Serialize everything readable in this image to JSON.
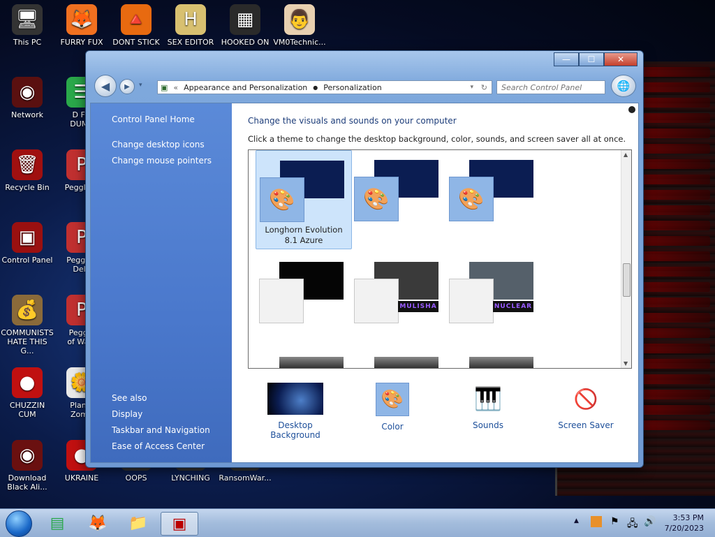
{
  "desktop": {
    "icons": [
      {
        "label": "This PC",
        "glyph": "🖥"
      },
      {
        "label": "FURRY FUX",
        "glyph": "🦊"
      },
      {
        "label": "DONT STICK",
        "glyph": "🔺"
      },
      {
        "label": "SEX EDITOR",
        "glyph": "H"
      },
      {
        "label": "HOOKED ON",
        "glyph": "▦"
      },
      {
        "label": "VM0Technic...",
        "glyph": "👨"
      },
      {
        "label": "Network",
        "glyph": "◉"
      },
      {
        "label": "D FO\nDUMB",
        "glyph": "☰"
      },
      {
        "label": "Recycle Bin",
        "glyph": "🗑"
      },
      {
        "label": "Peggle D",
        "glyph": "P"
      },
      {
        "label": "Control Panel",
        "glyph": "▣"
      },
      {
        "label": "Peggle I\nDelu",
        "glyph": "P"
      },
      {
        "label": "COMMUNISTS\nHATE THIS G...",
        "glyph": "💰"
      },
      {
        "label": "Peggle\nof Warc",
        "glyph": "P"
      },
      {
        "label": "CHUZZIN\nCUM",
        "glyph": "●"
      },
      {
        "label": "Plants\nZomb",
        "glyph": "🌼"
      },
      {
        "label": "Download\nBlack Ali...",
        "glyph": "◉"
      },
      {
        "label": "UKRAINE",
        "glyph": "●"
      },
      {
        "label": "OOPS",
        "glyph": ""
      },
      {
        "label": "LYNCHING",
        "glyph": ""
      },
      {
        "label": "RansomWar...",
        "glyph": ""
      }
    ]
  },
  "window": {
    "caption": {
      "minimize": "—",
      "maximize": "☐",
      "close": "✕"
    },
    "breadcrumb": {
      "prefix": "«",
      "items": [
        "Appearance and Personalization",
        "Personalization"
      ]
    },
    "search_placeholder": "Search Control Panel",
    "sidebar": {
      "home": "Control Panel Home",
      "links": [
        "Change desktop icons",
        "Change mouse pointers"
      ],
      "see_also_heading": "See also",
      "see_also": [
        "Display",
        "Taskbar and Navigation",
        "Ease of Access Center"
      ]
    },
    "main": {
      "title": "Change the visuals and sounds on your computer",
      "subtitle": "Click a theme to change the desktop background, color, sounds, and screen saver all at once.",
      "themes": [
        {
          "name": "Longhorn Evolution\n8.1 Azure",
          "selected": true,
          "bg": "#0b1d52",
          "badge": ""
        },
        {
          "name": "",
          "selected": false,
          "bg": "#0b1d52",
          "badge": ""
        },
        {
          "name": "",
          "selected": false,
          "bg": "#0b1d52",
          "badge": ""
        },
        {
          "name": "",
          "selected": false,
          "bg": "#050505",
          "badge": ""
        },
        {
          "name": "",
          "selected": false,
          "bg": "#3a3a3a",
          "badge": "MULISHA"
        },
        {
          "name": "",
          "selected": false,
          "bg": "#55606a",
          "badge": "NUCLEAR"
        }
      ],
      "bottom": [
        {
          "label": "Desktop Background",
          "glyph": ""
        },
        {
          "label": "Color",
          "glyph": "🎨"
        },
        {
          "label": "Sounds",
          "glyph": "🎹"
        },
        {
          "label": "Screen Saver",
          "glyph": "🚫"
        }
      ]
    }
  },
  "taskbar": {
    "time": "3:53 PM",
    "date": "7/20/2023"
  }
}
